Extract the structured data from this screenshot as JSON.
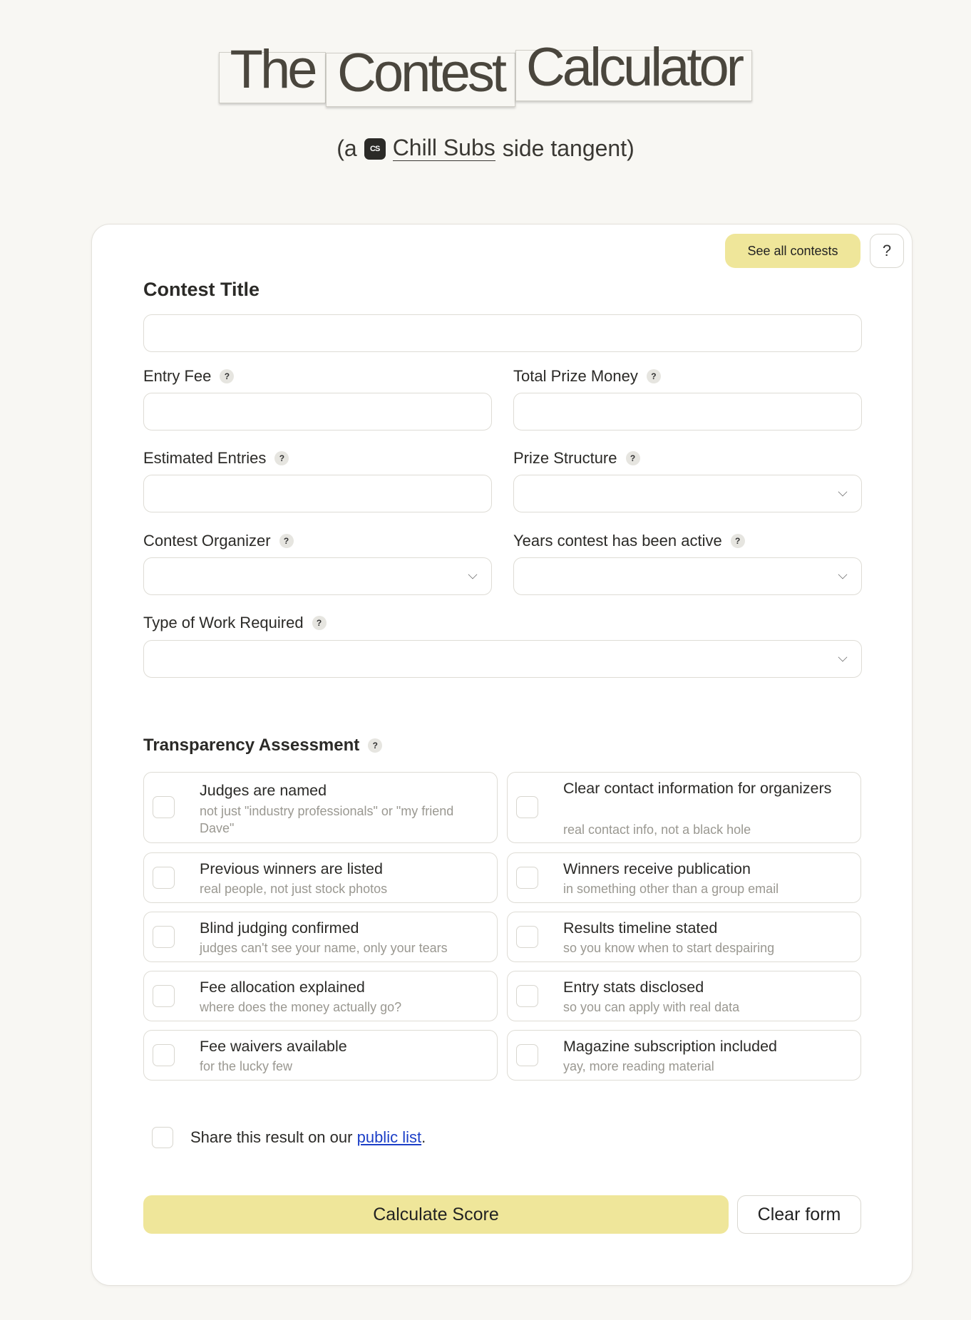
{
  "title": {
    "words": [
      "The",
      "Contest",
      "Calculator"
    ]
  },
  "subtitle": {
    "prefix": "(a",
    "logo_text": "CS",
    "link": "Chill Subs",
    "suffix": "side tangent)"
  },
  "header_buttons": {
    "see_all": "See all contests",
    "help": "?"
  },
  "form": {
    "contest_title_label": "Contest Title",
    "entry_fee_label": "Entry Fee",
    "total_prize_label": "Total Prize Money",
    "estimated_entries_label": "Estimated Entries",
    "prize_structure_label": "Prize Structure",
    "organizer_label": "Contest Organizer",
    "years_active_label": "Years contest has been active",
    "work_type_label": "Type of Work Required",
    "help_mark": "?"
  },
  "transparency": {
    "heading": "Transparency Assessment",
    "items": [
      {
        "main": "Judges are named",
        "sub": "not just \"industry professionals\" or \"my friend Dave\""
      },
      {
        "main": "Clear contact information for organizers",
        "sub": "real contact info, not a black hole"
      },
      {
        "main": "Previous winners are listed",
        "sub": "real people, not just stock photos"
      },
      {
        "main": "Winners receive publication",
        "sub": "in something other than a group email"
      },
      {
        "main": "Blind judging confirmed",
        "sub": "judges can't see your name, only your tears"
      },
      {
        "main": "Results timeline stated",
        "sub": "so you know when to start despairing"
      },
      {
        "main": "Fee allocation explained",
        "sub": "where does the money actually go?"
      },
      {
        "main": "Entry stats disclosed",
        "sub": "so you can apply with real data"
      },
      {
        "main": "Fee waivers available",
        "sub": "for the lucky few"
      },
      {
        "main": "Magazine subscription included",
        "sub": "yay, more reading material"
      }
    ]
  },
  "share": {
    "prefix": "Share this result on our",
    "link": "public list",
    "suffix": "."
  },
  "actions": {
    "calculate": "Calculate Score",
    "clear": "Clear form"
  },
  "colors": {
    "accent": "#efe69a",
    "background": "#f8f7f3",
    "link": "#1c3fc7"
  }
}
